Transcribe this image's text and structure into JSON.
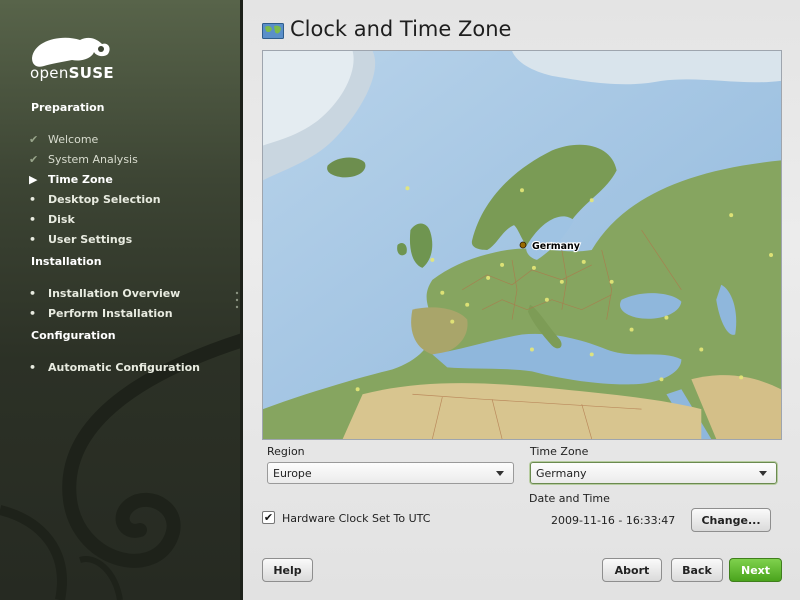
{
  "window": {
    "title": "Clock and Time Zone"
  },
  "brand": {
    "logo_prefix": "open",
    "logo_suffix": "SUSE"
  },
  "sidebar": {
    "sections": [
      {
        "label": "Preparation",
        "steps": [
          {
            "label": "Welcome",
            "state": "done"
          },
          {
            "label": "System Analysis",
            "state": "done"
          },
          {
            "label": "Time Zone",
            "state": "current"
          },
          {
            "label": "Desktop Selection",
            "state": "todo"
          },
          {
            "label": "Disk",
            "state": "todo"
          },
          {
            "label": "User Settings",
            "state": "todo"
          }
        ]
      },
      {
        "label": "Installation",
        "steps": [
          {
            "label": "Installation Overview",
            "state": "todo"
          },
          {
            "label": "Perform Installation",
            "state": "todo"
          }
        ]
      },
      {
        "label": "Configuration",
        "steps": [
          {
            "label": "Automatic Configuration",
            "state": "todo"
          }
        ]
      }
    ]
  },
  "map": {
    "selected_label": "Germany"
  },
  "form": {
    "region_label": "Region",
    "region_value": "Europe",
    "timezone_label": "Time Zone",
    "timezone_value": "Germany",
    "datetime_label": "Date and Time",
    "datetime_value": "2009-11-16 - 16:33:47",
    "change_label": "Change...",
    "utc_label": "Hardware Clock Set To UTC",
    "utc_checked": true
  },
  "buttons": {
    "help": "Help",
    "abort": "Abort",
    "back": "Back",
    "next": "Next"
  },
  "colors": {
    "sidebar": "#2c3126",
    "accent_green": "#4aa41d",
    "water": "#9fc3e3",
    "land": "#86a560"
  }
}
